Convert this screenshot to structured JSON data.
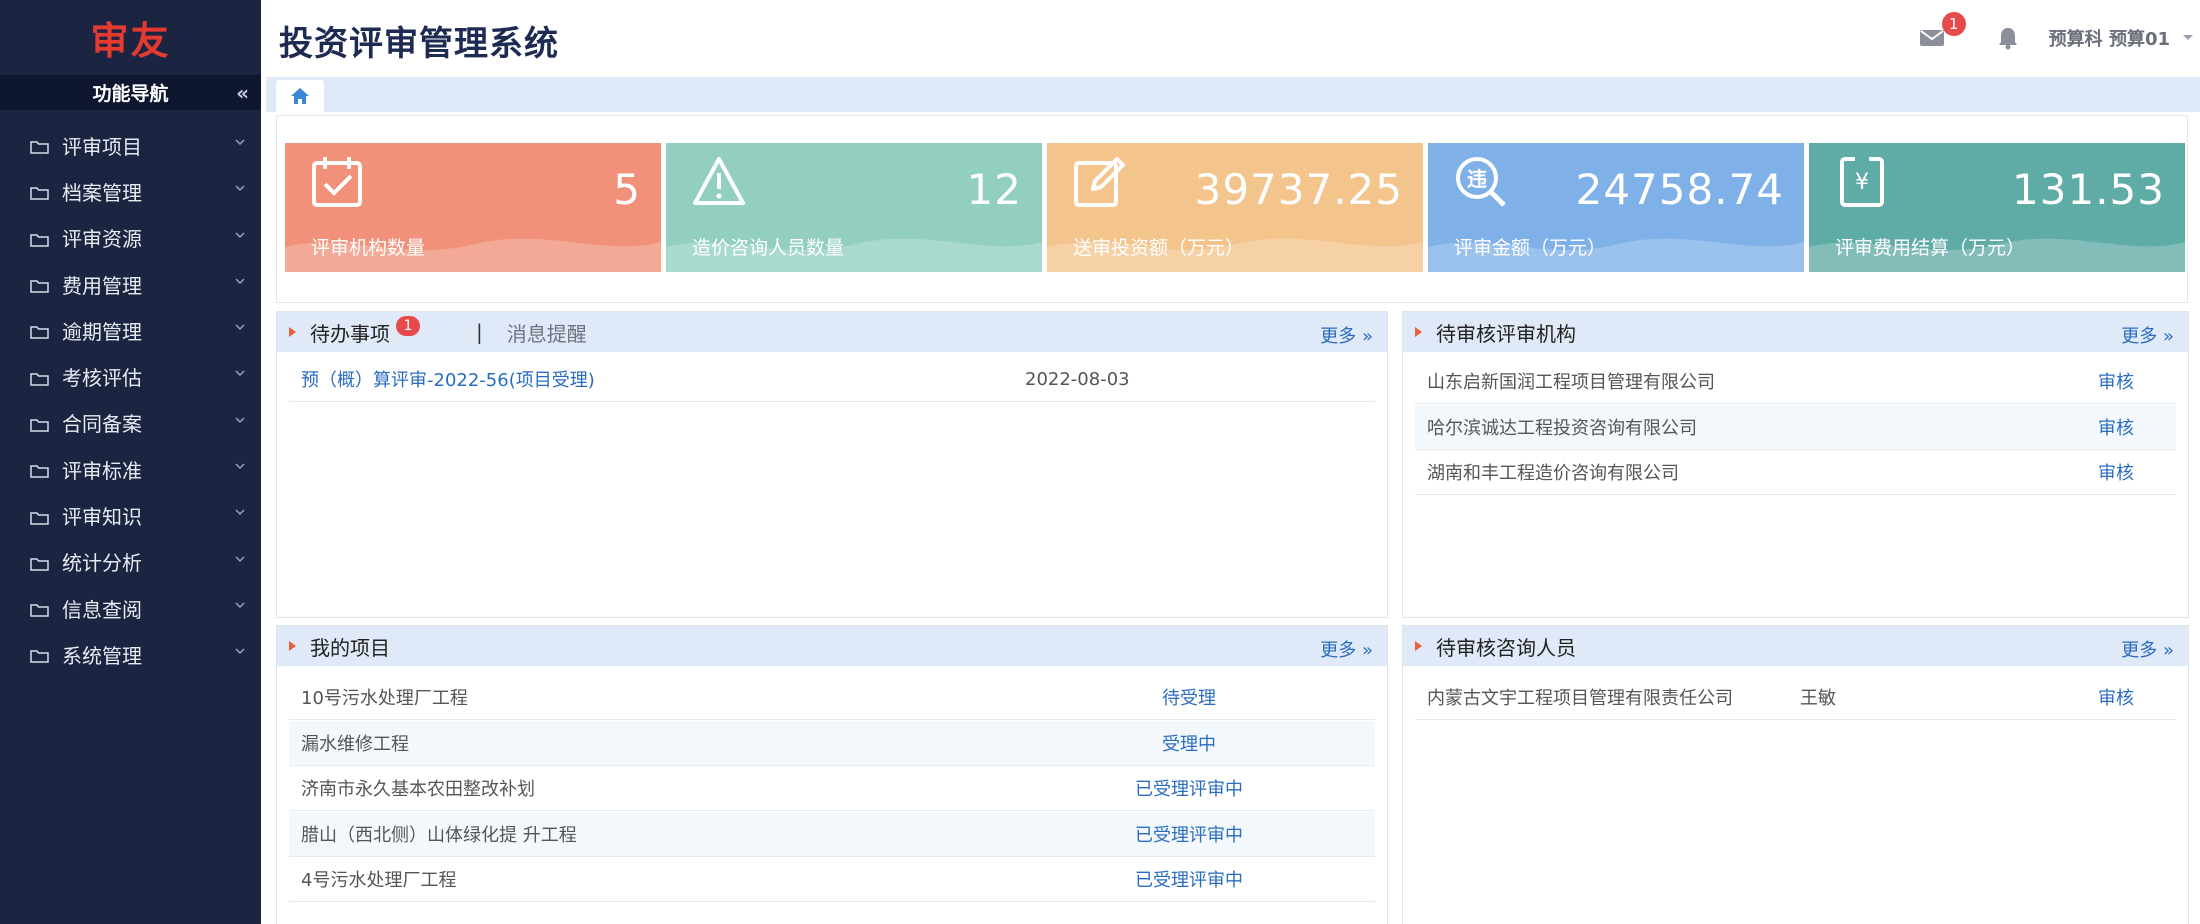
{
  "brand": {
    "logo_text": "审友",
    "color": "#e33b30"
  },
  "sidebar": {
    "header": "功能导航",
    "collapse_glyph": "«",
    "items": [
      {
        "label": "评审项目"
      },
      {
        "label": "档案管理"
      },
      {
        "label": "评审资源"
      },
      {
        "label": "费用管理"
      },
      {
        "label": "逾期管理"
      },
      {
        "label": "考核评估"
      },
      {
        "label": "合同备案"
      },
      {
        "label": "评审标准"
      },
      {
        "label": "评审知识"
      },
      {
        "label": "统计分析"
      },
      {
        "label": "信息查阅"
      },
      {
        "label": "系统管理"
      }
    ]
  },
  "header": {
    "title": "投资评审管理系统",
    "mail_badge": "1",
    "user": "预算科  预算01"
  },
  "stats": [
    {
      "value": "5",
      "label": "评审机构数量",
      "icon": "calendar-check-icon",
      "color": "#f1917a"
    },
    {
      "value": "12",
      "label": "造价咨询人员数量",
      "icon": "warning-icon",
      "color": "#92cfc0"
    },
    {
      "value": "39737.25",
      "label": "送审投资额（万元）",
      "icon": "edit-icon",
      "color": "#f4c48d"
    },
    {
      "value": "24758.74",
      "label": "评审金额（万元）",
      "icon": "search-violation-icon",
      "color": "#7fb0e8"
    },
    {
      "value": "131.53",
      "label": "评审费用结算（万元）",
      "icon": "yuan-document-icon",
      "color": "#5faba6"
    }
  ],
  "todo_panel": {
    "title": "待办事项",
    "badge": "1",
    "separator": "|",
    "tab2": "消息提醒",
    "more": "更多 »",
    "rows": [
      {
        "name": "预（概）算评审-2022-56(项目受理)",
        "date": "2022-08-03"
      }
    ]
  },
  "org_panel": {
    "title": "待审核评审机构",
    "more": "更多 »",
    "rows": [
      {
        "name": "山东启新国润工程项目管理有限公司",
        "action": "审核"
      },
      {
        "name": "哈尔滨诚达工程投资咨询有限公司",
        "action": "审核"
      },
      {
        "name": "湖南和丰工程造价咨询有限公司",
        "action": "审核"
      }
    ]
  },
  "project_panel": {
    "title": "我的项目",
    "more": "更多 »",
    "rows": [
      {
        "name": "10号污水处理厂工程",
        "status": "待受理"
      },
      {
        "name": "漏水维修工程",
        "status": "受理中"
      },
      {
        "name": "济南市永久基本农田整改补划",
        "status": "已受理评审中"
      },
      {
        "name": "腊山（西北侧）山体绿化提 升工程",
        "status": "已受理评审中"
      },
      {
        "name": "4号污水处理厂工程",
        "status": "已受理评审中"
      }
    ]
  },
  "consultant_panel": {
    "title": "待审核咨询人员",
    "more": "更多 »",
    "rows": [
      {
        "org": "内蒙古文宇工程项目管理有限责任公司",
        "person": "王敏",
        "action": "审核"
      }
    ]
  },
  "colors": {
    "sidebar_bg": "#1b2440",
    "panel_header_bg": "#e0e9f7",
    "link": "#2a6cc2",
    "accent_triangle": "#e5613f"
  }
}
